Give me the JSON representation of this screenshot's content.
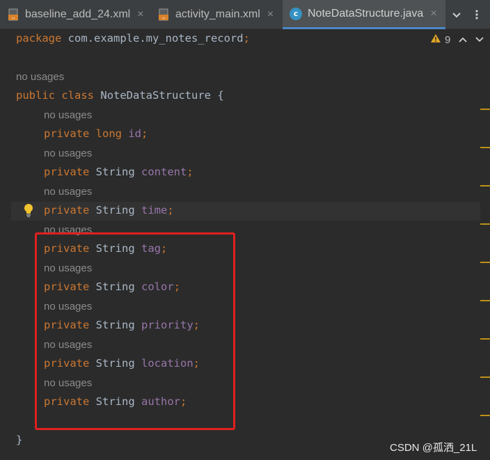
{
  "tabs": [
    {
      "label": "baseline_add_24.xml",
      "close": "×",
      "icon": "xml-file-icon"
    },
    {
      "label": "activity_main.xml",
      "close": "×",
      "icon": "xml-file-icon"
    },
    {
      "label": "NoteDataStructure.java",
      "close": "×",
      "icon": "java-class-icon",
      "icon_letter": "c",
      "active": true
    }
  ],
  "editor": {
    "warnings_count": "9",
    "package_keyword": "package",
    "package_name": "com.example.my_notes_record",
    "semicolon": ";",
    "usage_hint": "no usages",
    "class_line": {
      "modifier": "public",
      "keyword": "class",
      "name": "NoteDataStructure",
      "brace": "{"
    },
    "fields": [
      {
        "modifier": "private",
        "type": "long",
        "name": "id"
      },
      {
        "modifier": "private",
        "type": "String",
        "name": "content"
      },
      {
        "modifier": "private",
        "type": "String",
        "name": "time"
      },
      {
        "modifier": "private",
        "type": "String",
        "name": "tag"
      },
      {
        "modifier": "private",
        "type": "String",
        "name": "color"
      },
      {
        "modifier": "private",
        "type": "String",
        "name": "priority"
      },
      {
        "modifier": "private",
        "type": "String",
        "name": "location"
      },
      {
        "modifier": "private",
        "type": "String",
        "name": "author"
      }
    ],
    "closing_brace": "}"
  },
  "watermark": "CSDN @孤洒_21L",
  "colors": {
    "keyword": "#cc7832",
    "field": "#9876aa",
    "text": "#a9b7c6",
    "hint": "#8c8c8c",
    "warning_marker": "#be9117",
    "annotation_box": "#e02020",
    "active_tab_underline": "#4a88c7"
  }
}
